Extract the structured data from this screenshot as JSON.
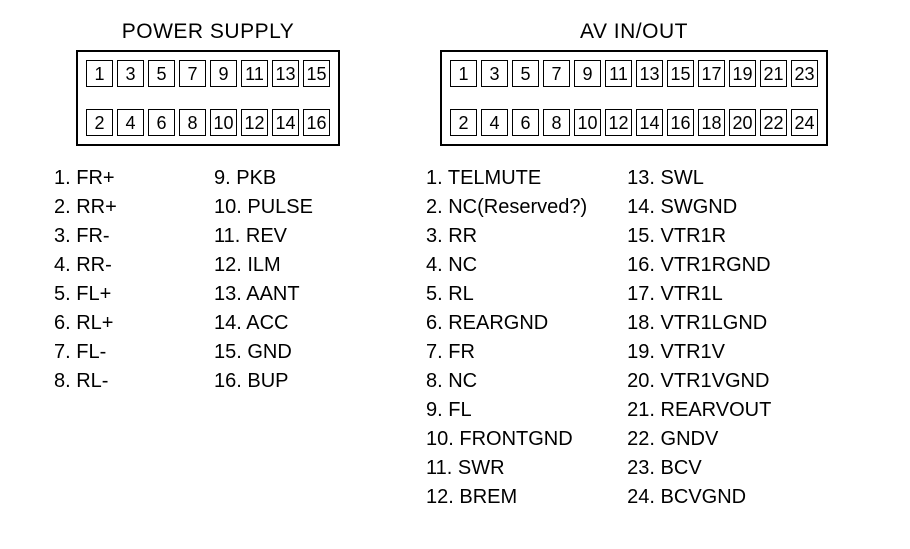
{
  "power_supply": {
    "title": "POWER SUPPLY",
    "top_pins": [
      "1",
      "3",
      "5",
      "7",
      "9",
      "11",
      "13",
      "15"
    ],
    "bottom_pins": [
      "2",
      "4",
      "6",
      "8",
      "10",
      "12",
      "14",
      "16"
    ],
    "signals": [
      {
        "n": 1,
        "name": "FR+"
      },
      {
        "n": 2,
        "name": "RR+"
      },
      {
        "n": 3,
        "name": "FR-"
      },
      {
        "n": 4,
        "name": "RR-"
      },
      {
        "n": 5,
        "name": "FL+"
      },
      {
        "n": 6,
        "name": "RL+"
      },
      {
        "n": 7,
        "name": "FL-"
      },
      {
        "n": 8,
        "name": "RL-"
      },
      {
        "n": 9,
        "name": "PKB"
      },
      {
        "n": 10,
        "name": "PULSE"
      },
      {
        "n": 11,
        "name": "REV"
      },
      {
        "n": 12,
        "name": "ILM"
      },
      {
        "n": 13,
        "name": "AANT"
      },
      {
        "n": 14,
        "name": "ACC"
      },
      {
        "n": 15,
        "name": "GND"
      },
      {
        "n": 16,
        "name": "BUP"
      }
    ]
  },
  "av_in_out": {
    "title": "AV IN/OUT",
    "top_pins": [
      "1",
      "3",
      "5",
      "7",
      "9",
      "11",
      "13",
      "15",
      "17",
      "19",
      "21",
      "23"
    ],
    "bottom_pins": [
      "2",
      "4",
      "6",
      "8",
      "10",
      "12",
      "14",
      "16",
      "18",
      "20",
      "22",
      "24"
    ],
    "signals": [
      {
        "n": 1,
        "name": "TELMUTE"
      },
      {
        "n": 2,
        "name": "NC(Reserved?)"
      },
      {
        "n": 3,
        "name": "RR"
      },
      {
        "n": 4,
        "name": "NC"
      },
      {
        "n": 5,
        "name": "RL"
      },
      {
        "n": 6,
        "name": "REARGND"
      },
      {
        "n": 7,
        "name": "FR"
      },
      {
        "n": 8,
        "name": "NC"
      },
      {
        "n": 9,
        "name": "FL"
      },
      {
        "n": 10,
        "name": "FRONTGND"
      },
      {
        "n": 11,
        "name": "SWR"
      },
      {
        "n": 12,
        "name": "BREM"
      },
      {
        "n": 13,
        "name": "SWL"
      },
      {
        "n": 14,
        "name": "SWGND"
      },
      {
        "n": 15,
        "name": "VTR1R"
      },
      {
        "n": 16,
        "name": "VTR1RGND"
      },
      {
        "n": 17,
        "name": "VTR1L"
      },
      {
        "n": 18,
        "name": "VTR1LGND"
      },
      {
        "n": 19,
        "name": "VTR1V"
      },
      {
        "n": 20,
        "name": "VTR1VGND"
      },
      {
        "n": 21,
        "name": "REARVOUT"
      },
      {
        "n": 22,
        "name": "GNDV"
      },
      {
        "n": 23,
        "name": "BCV"
      },
      {
        "n": 24,
        "name": "BCVGND"
      }
    ]
  }
}
